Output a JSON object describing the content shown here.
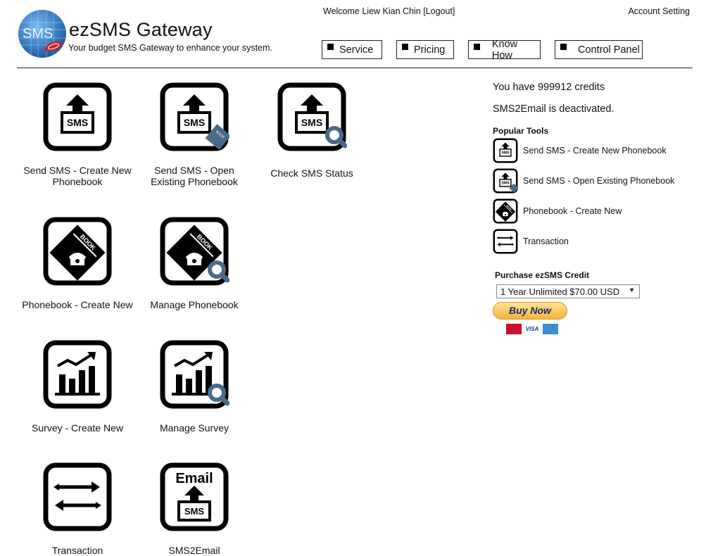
{
  "header": {
    "brand": "ezSMS Gateway",
    "tagline": "Your budget SMS Gateway to enhance your system.",
    "logo_text": "SMS",
    "welcome": "Welcome Liew Kian Chin",
    "logout": "[Logout]",
    "account_setting": "Account Setting",
    "nav": [
      "Service",
      "Pricing",
      "Know How",
      "Control Panel"
    ]
  },
  "tiles": [
    {
      "label": "Send SMS - Create New Phonebook",
      "icon": "send-sms-icon"
    },
    {
      "label": "Send SMS - Open Existing Phonebook",
      "icon": "send-sms-book-icon"
    },
    {
      "label": "Check SMS Status",
      "icon": "sms-status-icon"
    },
    {
      "label": "Phonebook - Create New",
      "icon": "phonebook-icon"
    },
    {
      "label": "Manage Phonebook",
      "icon": "manage-phonebook-icon"
    },
    {
      "label": "Survey - Create New",
      "icon": "survey-chart-icon"
    },
    {
      "label": "Manage Survey",
      "icon": "manage-survey-icon"
    },
    {
      "label": "Transaction",
      "icon": "transaction-arrows-icon"
    },
    {
      "label": "SMS2Email",
      "icon": "sms2email-icon"
    }
  ],
  "icon_text": {
    "sms": "SMS",
    "book": "BOOK",
    "email": "Email"
  },
  "sidebar": {
    "credits": "You have 999912 credits",
    "sms2email_status": "SMS2Email is deactivated.",
    "popular_tools_title": "Popular Tools",
    "popular_tools": [
      "Send SMS - Create New Phonebook",
      "Send SMS - Open Existing Phonebook",
      "Phonebook - Create New",
      "Transaction"
    ],
    "purchase_title": "Purchase ezSMS Credit",
    "purchase_option": "1 Year Unlimited $70.00 USD",
    "buy_now": "Buy Now",
    "card_labels": [
      "MasterCard",
      "VISA",
      "AMEX"
    ]
  },
  "colors": {
    "magnifier": "#4a6a8a",
    "logo_blue": "#2a6fb3",
    "paypal_gold": "#f5b335"
  }
}
